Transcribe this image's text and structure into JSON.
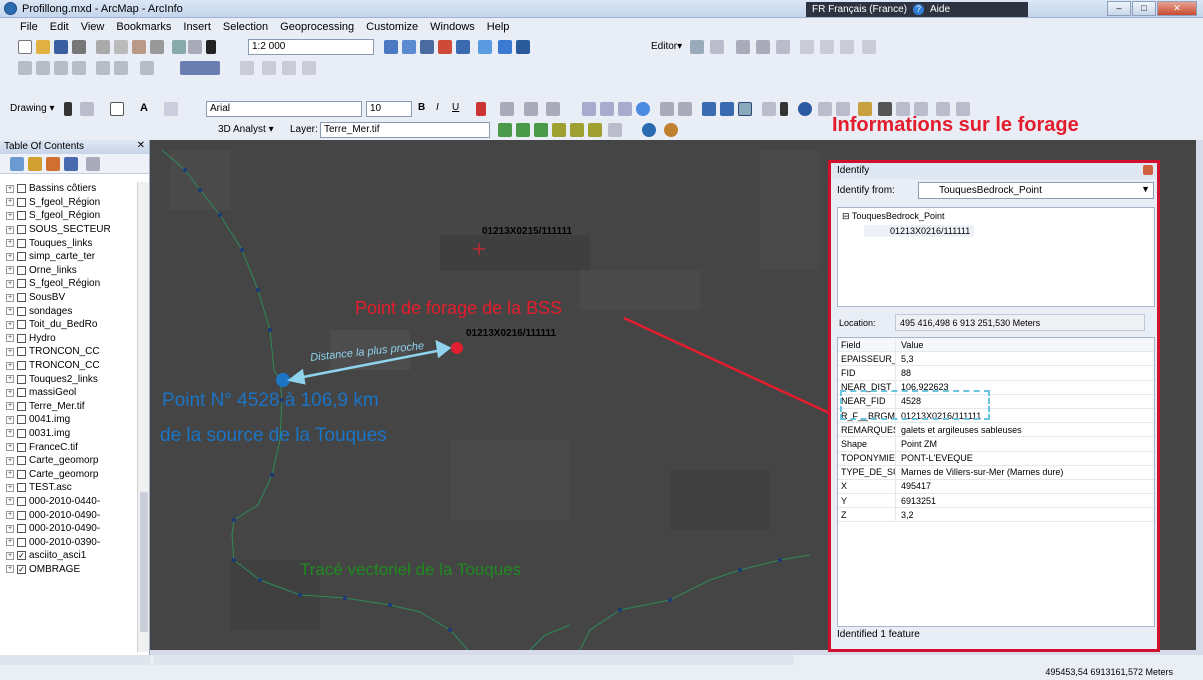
{
  "window": {
    "title": "Profillong.mxd - ArcMap - ArcInfo",
    "language": "FR Français (France)",
    "help": "Aide"
  },
  "menu": [
    "File",
    "Edit",
    "View",
    "Bookmarks",
    "Insert",
    "Selection",
    "Geoprocessing",
    "Customize",
    "Windows",
    "Help"
  ],
  "toolbar": {
    "scale": "1:2 000",
    "editor": "Editor▾",
    "drawing": "Drawing ▾",
    "font": "Arial",
    "font_size": "10",
    "analyst": "3D Analyst ▾",
    "layer_label": "Layer:",
    "layer_value": "Terre_Mer.tif"
  },
  "toc": {
    "title": "Table Of Contents",
    "items": [
      {
        "label": "Bassins côtiers",
        "checked": false
      },
      {
        "label": "S_fgeol_Région",
        "checked": false
      },
      {
        "label": "S_fgeol_Région",
        "checked": false
      },
      {
        "label": "SOUS_SECTEUR",
        "checked": false
      },
      {
        "label": "Touques_links",
        "checked": false
      },
      {
        "label": "simp_carte_ter",
        "checked": false
      },
      {
        "label": "Orne_links",
        "checked": false
      },
      {
        "label": "S_fgeol_Région",
        "checked": false
      },
      {
        "label": "SousBV",
        "checked": false
      },
      {
        "label": "sondages",
        "checked": false
      },
      {
        "label": "Toit_du_BedRo",
        "checked": false
      },
      {
        "label": "Hydro",
        "checked": false
      },
      {
        "label": "TRONCON_CC",
        "checked": false
      },
      {
        "label": "TRONCON_CC",
        "checked": false
      },
      {
        "label": "Touques2_links",
        "checked": false
      },
      {
        "label": "massiGeol",
        "checked": false
      },
      {
        "label": "Terre_Mer.tif",
        "checked": false
      },
      {
        "label": "0041.img",
        "checked": false
      },
      {
        "label": "0031.img",
        "checked": false
      },
      {
        "label": "FranceC.tif",
        "checked": false
      },
      {
        "label": "Carte_geomorp",
        "checked": false
      },
      {
        "label": "Carte_geomorp",
        "checked": false
      },
      {
        "label": "TEST.asc",
        "checked": false
      },
      {
        "label": "000-2010-0440-",
        "checked": false
      },
      {
        "label": "000-2010-0490-",
        "checked": false
      },
      {
        "label": "000-2010-0490-",
        "checked": false
      },
      {
        "label": "000-2010-0390-",
        "checked": false
      },
      {
        "label": "asciito_asci1",
        "checked": true
      },
      {
        "label": "OMBRAGE",
        "checked": true
      }
    ]
  },
  "map": {
    "label_point1": "01213X0215/111111",
    "label_point2": "01213X0216/111111",
    "anno_bss": "Point de forage de la BSS",
    "anno_distance": "Distance la plus proche",
    "anno_point_line1": "Point N° 4528 à 106,9 km",
    "anno_point_line2": "de la source de la Touques",
    "anno_trace": "Tracé vectoriel de la Touques",
    "anno_info": "Informations sur le forage",
    "colors": {
      "red": "#e02030",
      "blue": "#1b74c4",
      "green": "#1f8a1f",
      "annotation_red": "#e41d2d"
    }
  },
  "identify": {
    "title": "Identify",
    "from_label": "Identify from:",
    "from_value": "TouquesBedrock_Point",
    "tree_root": "TouquesBedrock_Point",
    "tree_child": "01213X0216/111111",
    "location_label": "Location:",
    "location_value": "495 416,498  6 913 251,530 Meters",
    "col_field": "Field",
    "col_value": "Value",
    "rows": [
      {
        "f": "EPAISSEUR_",
        "v": "5,3"
      },
      {
        "f": "FID",
        "v": "88"
      },
      {
        "f": "NEAR_DIST",
        "v": "106,922623"
      },
      {
        "f": "NEAR_FID",
        "v": "4528"
      },
      {
        "f": "R_F__BRGM",
        "v": "01213X0216/111111"
      },
      {
        "f": "REMARQUES",
        "v": "galets et argileuses sableuses"
      },
      {
        "f": "Shape",
        "v": "Point ZM"
      },
      {
        "f": "TOPONYMIE",
        "v": "PONT-L'EVEQUE"
      },
      {
        "f": "TYPE_DE_SU",
        "v": "Marnes de Villers-sur-Mer (Marnes dure)"
      },
      {
        "f": "X",
        "v": "495417"
      },
      {
        "f": "Y",
        "v": "6913251"
      },
      {
        "f": "Z",
        "v": "3,2"
      }
    ],
    "footer": "Identified 1 feature"
  },
  "status": {
    "coords": "495453,54  6913161,572 Meters"
  }
}
